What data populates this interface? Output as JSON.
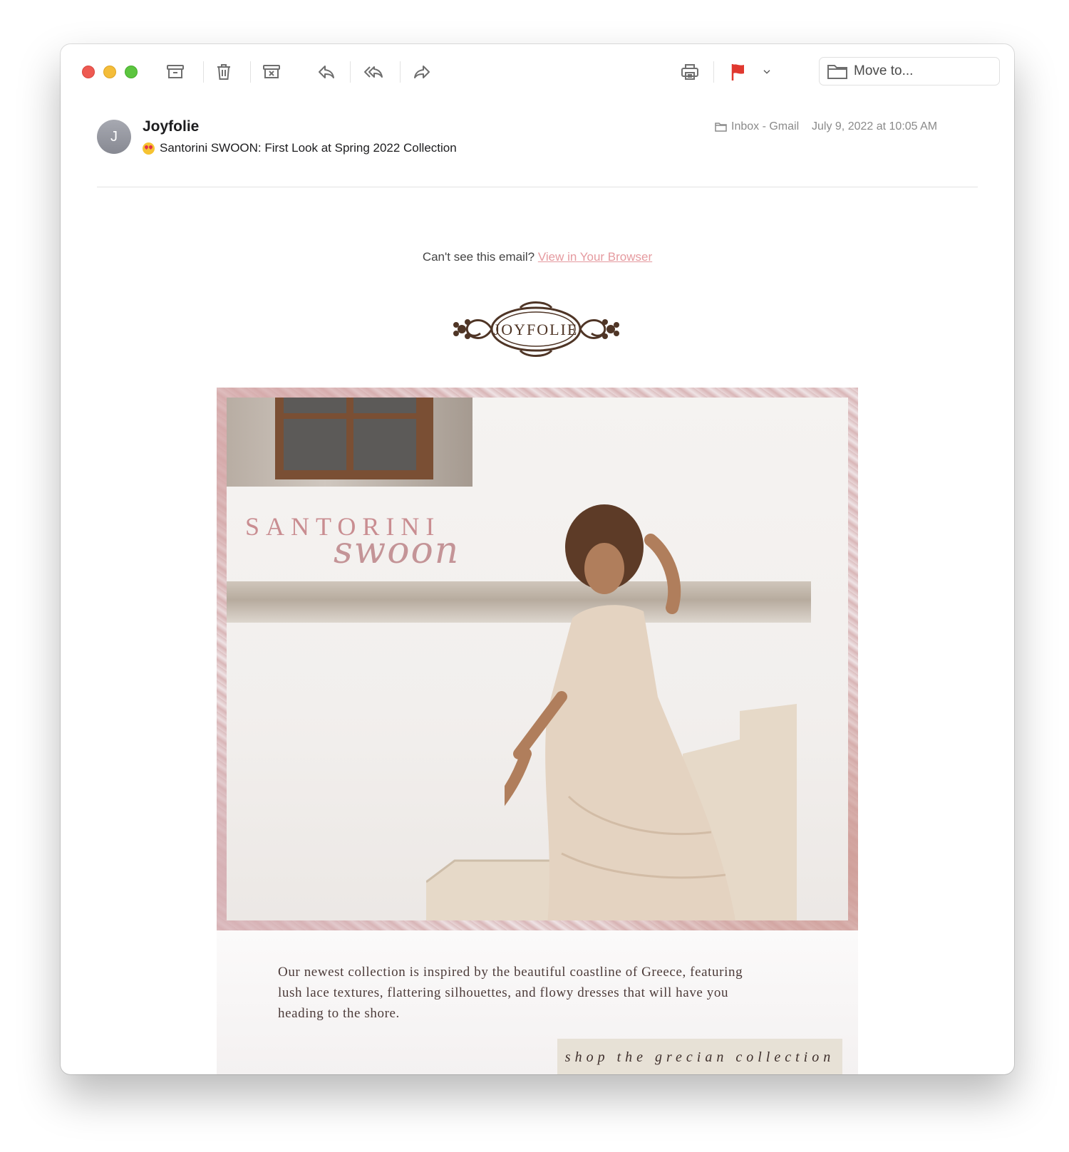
{
  "toolbar": {
    "archive": "archive-icon",
    "trash": "trash-icon",
    "junk": "junk-icon",
    "reply": "reply-icon",
    "reply_all": "reply-all-icon",
    "forward": "forward-icon",
    "print": "print-icon",
    "flag": "flag-icon",
    "flag_color": "#e0382f",
    "move_to_label": "Move to..."
  },
  "header": {
    "avatar_initial": "J",
    "sender": "Joyfolie",
    "subject": "Santorini SWOON: First Look at Spring 2022 Collection",
    "mailbox": "Inbox - Gmail",
    "date": "July 9, 2022 at 10:05 AM"
  },
  "email": {
    "cant_see_text": "Can't see this email?",
    "view_in_browser": "View in Your Browser",
    "link_color": "#e59a9f",
    "logo_text": "JOYFOLIE",
    "hero_title": "SANTORINI",
    "hero_script": "swoon",
    "body_text": "Our newest collection is inspired by the beautiful coastline of Greece, featuring lush lace textures, flattering silhouettes, and flowy dresses that will have you heading to the shore.",
    "shop_button": "shop the grecian collection"
  }
}
